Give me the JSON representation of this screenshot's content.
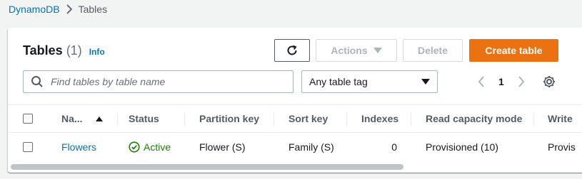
{
  "breadcrumb": {
    "root": "DynamoDB",
    "current": "Tables"
  },
  "panel": {
    "title": "Tables",
    "count": "(1)",
    "info": "Info"
  },
  "toolbar": {
    "actions_label": "Actions",
    "delete_label": "Delete",
    "create_label": "Create table"
  },
  "search": {
    "placeholder": "Find tables by table name",
    "value": ""
  },
  "tag_filter": {
    "selected": "Any table tag"
  },
  "pagination": {
    "current_page": "1"
  },
  "table": {
    "columns": [
      "Na...",
      "Status",
      "Partition key",
      "Sort key",
      "Indexes",
      "Read capacity mode",
      "Write"
    ],
    "rows": [
      {
        "name": "Flowers",
        "status": "Active",
        "partition_key": "Flower (S)",
        "sort_key": "Family (S)",
        "indexes": "0",
        "read_capacity_mode": "Provisioned (10)",
        "write_capacity_mode": "Provis"
      }
    ]
  },
  "colors": {
    "accent": "#ec7211",
    "link": "#0073bb",
    "success": "#1d8102"
  }
}
